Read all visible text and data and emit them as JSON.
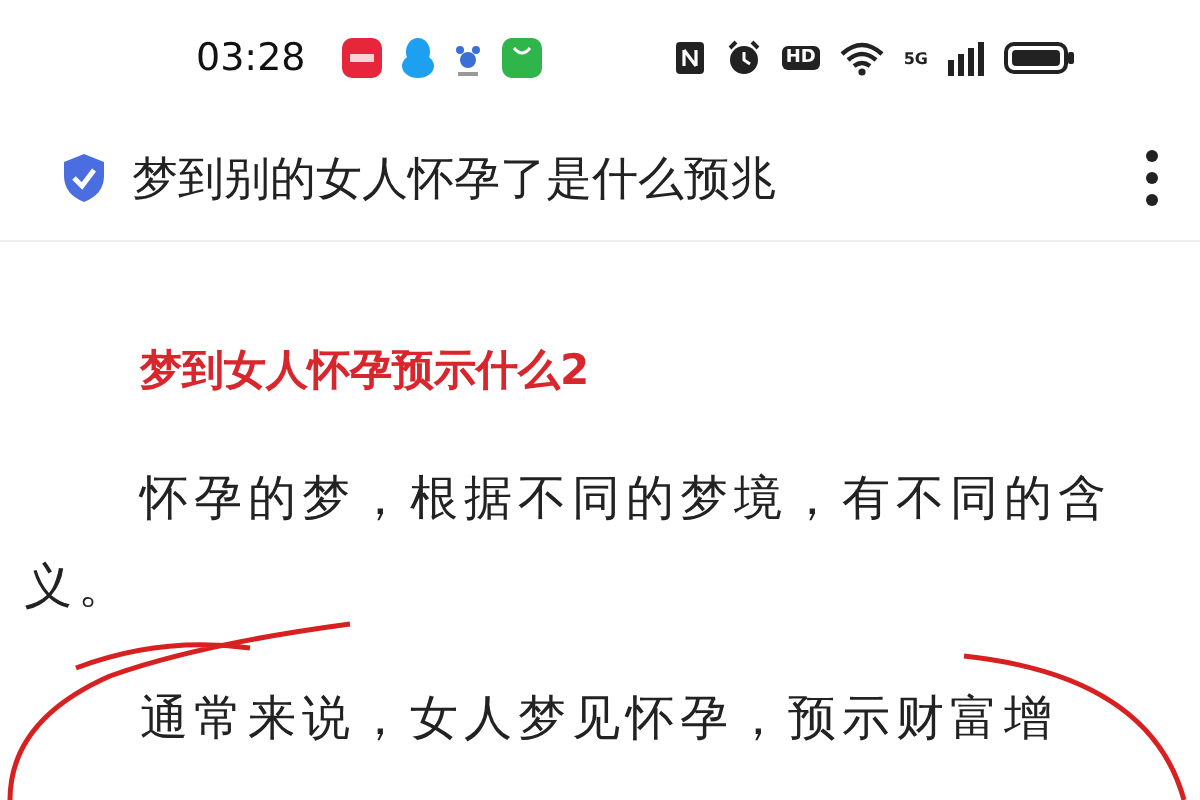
{
  "status_bar": {
    "time": "03:28",
    "hd_label": "HD",
    "network_label": "5G"
  },
  "title_bar": {
    "title": "梦到别的女人怀孕了是什么预兆"
  },
  "article": {
    "heading": "梦到女人怀孕预示什么2",
    "paragraphs": [
      "怀孕的梦，根据不同的梦境，有不同的含义。",
      "通常来说，女人梦见怀孕，预示财富增"
    ]
  }
}
